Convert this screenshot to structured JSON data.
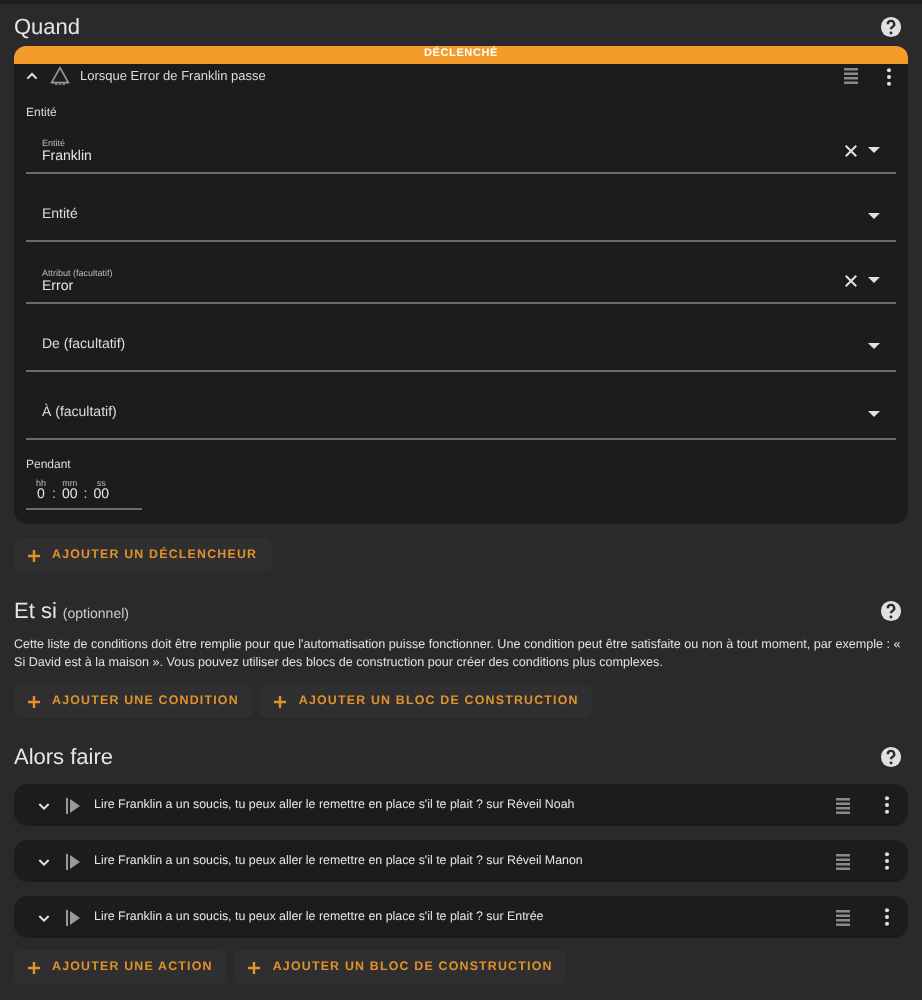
{
  "trigger_section": {
    "title": "Quand",
    "trigger": {
      "banner": "DÉCLENCHÉ",
      "expanded": true,
      "title": "Lorsque Error de Franklin passe",
      "group_label": "Entité",
      "fields": [
        {
          "label": "Entité",
          "value": "Franklin",
          "clearable": true
        },
        {
          "label": "Entité",
          "clearable": false
        },
        {
          "label": "Attribut (facultatif)",
          "value": "Error",
          "clearable": true
        },
        {
          "label": "De (facultatif)",
          "clearable": false
        },
        {
          "label": "À (facultatif)",
          "clearable": false
        }
      ],
      "duration": {
        "label": "Pendant",
        "separator": ":",
        "parts": [
          {
            "unit": "hh",
            "value": "0"
          },
          {
            "unit": "mm",
            "value": "00"
          },
          {
            "unit": "ss",
            "value": "00"
          }
        ]
      }
    },
    "buttons": [
      "AJOUTER UN DÉCLENCHEUR"
    ]
  },
  "condition_section": {
    "title": "Et si",
    "subtitle": "(optionnel)",
    "description": "Cette liste de conditions doit être remplie pour que l'automatisation puisse fonctionner. Une condition peut être satisfaite ou non à tout moment, par exemple : « Si David est à la maison ». Vous pouvez utiliser des blocs de construction pour créer des conditions plus complexes.",
    "buttons": [
      "AJOUTER UNE CONDITION",
      "AJOUTER UN BLOC DE CONSTRUCTION"
    ]
  },
  "action_section": {
    "title": "Alors faire",
    "actions": [
      {
        "title": "Lire Franklin a un soucis, tu peux aller le remettre en place s'il te plait ? sur Réveil Noah",
        "expanded": false
      },
      {
        "title": "Lire Franklin a un soucis, tu peux aller le remettre en place s'il te plait ? sur Réveil Manon",
        "expanded": false
      },
      {
        "title": "Lire Franklin a un soucis, tu peux aller le remettre en place s'il te plait ? sur Entrée",
        "expanded": false
      }
    ],
    "buttons": [
      "AJOUTER UNE ACTION",
      "AJOUTER UN BLOC DE CONSTRUCTION"
    ]
  }
}
